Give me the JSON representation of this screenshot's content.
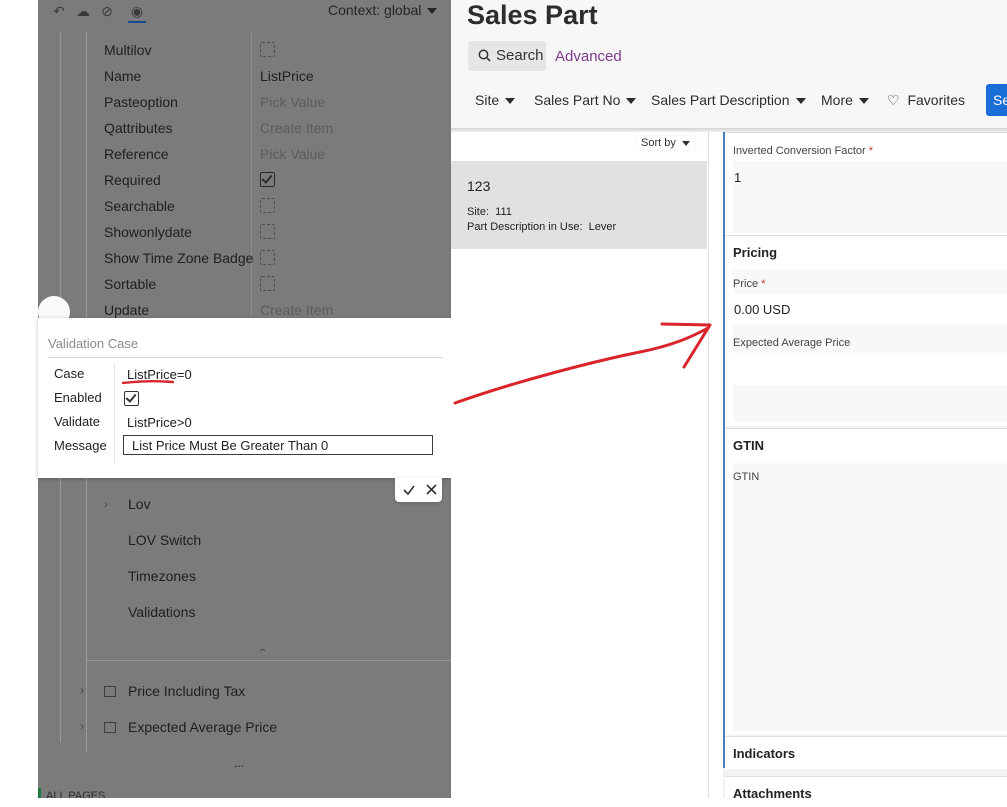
{
  "designer": {
    "context_label": "Context: global",
    "properties": [
      {
        "name": "Multilov",
        "kind": "checkbox",
        "checked": false
      },
      {
        "name": "Name",
        "kind": "text",
        "value": "ListPrice"
      },
      {
        "name": "Pasteoption",
        "kind": "placeholder",
        "value": "Pick Value"
      },
      {
        "name": "Qattributes",
        "kind": "placeholder",
        "value": "Create Item"
      },
      {
        "name": "Reference",
        "kind": "placeholder",
        "value": "Pick Value"
      },
      {
        "name": "Required",
        "kind": "checkbox",
        "checked": true
      },
      {
        "name": "Searchable",
        "kind": "checkbox",
        "checked": false
      },
      {
        "name": "Showonlydate",
        "kind": "checkbox",
        "checked": false
      },
      {
        "name": "Show Time Zone Badge",
        "kind": "checkbox",
        "checked": false
      },
      {
        "name": "Sortable",
        "kind": "checkbox",
        "checked": false
      },
      {
        "name": "Update",
        "kind": "placeholder",
        "value": "Create Item"
      }
    ],
    "tree": {
      "lov": "Lov",
      "lov_switch": "LOV Switch",
      "timezones": "Timezones",
      "validations": "Validations",
      "price_incl_tax": "Price Including Tax",
      "expected_avg_price": "Expected Average Price",
      "more": "...",
      "all_pages": "ALL PAGES"
    }
  },
  "validation_dialog": {
    "title": "Validation Case",
    "case_label": "Case",
    "case_value": "ListPrice=0",
    "enabled_label": "Enabled",
    "enabled": true,
    "validate_label": "Validate",
    "validate_value": "ListPrice>0",
    "message_label": "Message",
    "message_value": "List Price Must Be Greater Than 0"
  },
  "app": {
    "title": "Sales Part",
    "search_label": "Search",
    "advanced_label": "Advanced",
    "filters": [
      "Site",
      "Sales Part No",
      "Sales Part Description",
      "More"
    ],
    "favorites_label": "Favorites",
    "blue_button_label": "Se",
    "sort_by_label": "Sort by",
    "list_item": {
      "id": "123",
      "site_label": "Site:",
      "site_value": "111",
      "desc_label": "Part Description in Use:",
      "desc_value": "Lever"
    },
    "detail": {
      "inverted_conv_label": "Inverted Conversion Factor",
      "inverted_conv_value": "1",
      "pricing_title": "Pricing",
      "price_label": "Price",
      "price_value": "0.00 USD",
      "expected_avg_label": "Expected Average Price",
      "gtin_title": "GTIN",
      "gtin_label": "GTIN",
      "indicators_title": "Indicators",
      "attachments_title": "Attachments",
      "required_mark": "*"
    }
  },
  "colors": {
    "accent_link": "#7b3b8a",
    "primary_button": "#1a6ed8",
    "annotation_red": "#d9242b",
    "required_red": "#c0392b"
  }
}
